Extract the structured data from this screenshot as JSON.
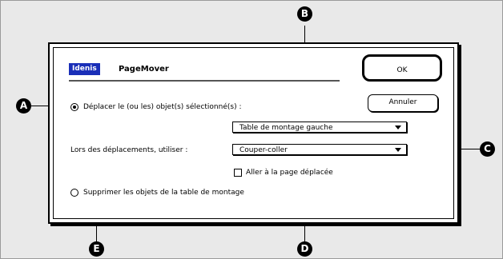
{
  "dialog": {
    "badge": "Idenis",
    "title": "PageMover",
    "ok_label": "OK",
    "cancel_label": "Annuler"
  },
  "options": {
    "move_label": "Déplacer le (ou les) objet(s) sélectionné(s) :",
    "move_checked": true,
    "destination_value": "Table de montage gauche",
    "use_label": "Lors des déplacements, utiliser :",
    "method_value": "Couper-coller",
    "goto_label": "Aller à la page déplacée",
    "goto_checked": false,
    "delete_label": "Supprimer les objets de la table de montage",
    "delete_checked": false
  },
  "callouts": {
    "a": "A",
    "b": "B",
    "c": "C",
    "d": "D",
    "e": "E"
  }
}
